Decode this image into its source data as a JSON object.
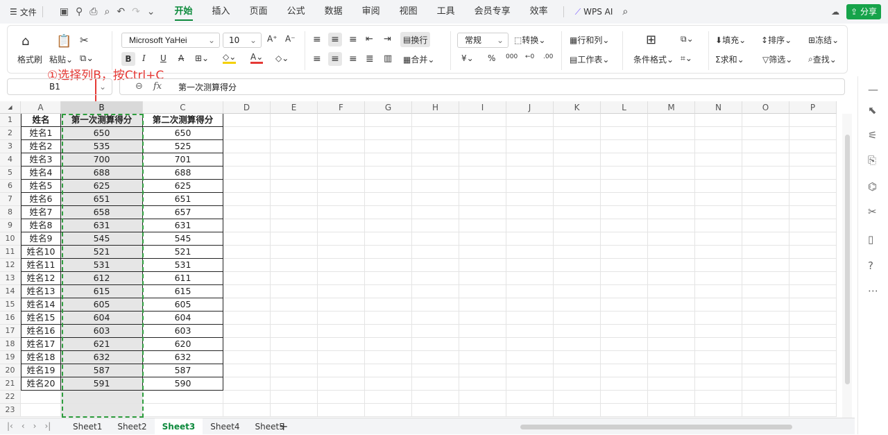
{
  "menu": {
    "file_label": "文件",
    "tabs": [
      "开始",
      "插入",
      "页面",
      "公式",
      "数据",
      "审阅",
      "视图",
      "工具",
      "会员专享",
      "效率"
    ],
    "active_tab": "开始",
    "wps_ai": "WPS AI",
    "share": "分享"
  },
  "ribbon": {
    "format_painter": "格式刷",
    "paste": "粘贴",
    "font_name": "Microsoft YaHei",
    "font_size": "10",
    "wrap": "换行",
    "merge": "合并",
    "number_format": "常规",
    "convert": "转换",
    "row_col": "行和列",
    "worksheet": "工作表",
    "cond_format": "条件格式",
    "fill": "填充",
    "sort": "排序",
    "freeze": "冻结",
    "sum": "求和",
    "filter": "筛选",
    "find": "查找"
  },
  "formula_bar": {
    "name_box": "B1",
    "fx": "fx",
    "content": "第一次测算得分"
  },
  "annotation": "①选择列B，按Ctrl+C",
  "columns": [
    "A",
    "B",
    "C",
    "D",
    "E",
    "F",
    "G",
    "H",
    "I",
    "J",
    "K",
    "L",
    "M",
    "N",
    "O",
    "P"
  ],
  "selected_column": "B",
  "sheet": {
    "headers": [
      "姓名",
      "第一次测算得分",
      "第二次测算得分"
    ],
    "rows": [
      [
        "姓名1",
        "650",
        "650"
      ],
      [
        "姓名2",
        "535",
        "525"
      ],
      [
        "姓名3",
        "700",
        "701"
      ],
      [
        "姓名4",
        "688",
        "688"
      ],
      [
        "姓名5",
        "625",
        "625"
      ],
      [
        "姓名6",
        "651",
        "651"
      ],
      [
        "姓名7",
        "658",
        "657"
      ],
      [
        "姓名8",
        "631",
        "631"
      ],
      [
        "姓名9",
        "545",
        "545"
      ],
      [
        "姓名10",
        "521",
        "521"
      ],
      [
        "姓名11",
        "531",
        "531"
      ],
      [
        "姓名12",
        "612",
        "611"
      ],
      [
        "姓名13",
        "615",
        "615"
      ],
      [
        "姓名14",
        "605",
        "605"
      ],
      [
        "姓名15",
        "604",
        "604"
      ],
      [
        "姓名16",
        "603",
        "603"
      ],
      [
        "姓名17",
        "621",
        "620"
      ],
      [
        "姓名18",
        "632",
        "632"
      ],
      [
        "姓名19",
        "587",
        "587"
      ],
      [
        "姓名20",
        "591",
        "590"
      ]
    ],
    "row_numbers": [
      "1",
      "2",
      "3",
      "4",
      "5",
      "6",
      "7",
      "8",
      "9",
      "10",
      "11",
      "12",
      "13",
      "14",
      "15",
      "16",
      "17",
      "18",
      "19",
      "20",
      "21",
      "22",
      "23"
    ]
  },
  "sheet_tabs": [
    "Sheet1",
    "Sheet2",
    "Sheet3",
    "Sheet4",
    "Sheet5"
  ],
  "active_sheet": "Sheet3",
  "colors": {
    "accent": "#0d8a3c",
    "annotation": "#e53935",
    "copy_border": "#2e9e3e"
  }
}
